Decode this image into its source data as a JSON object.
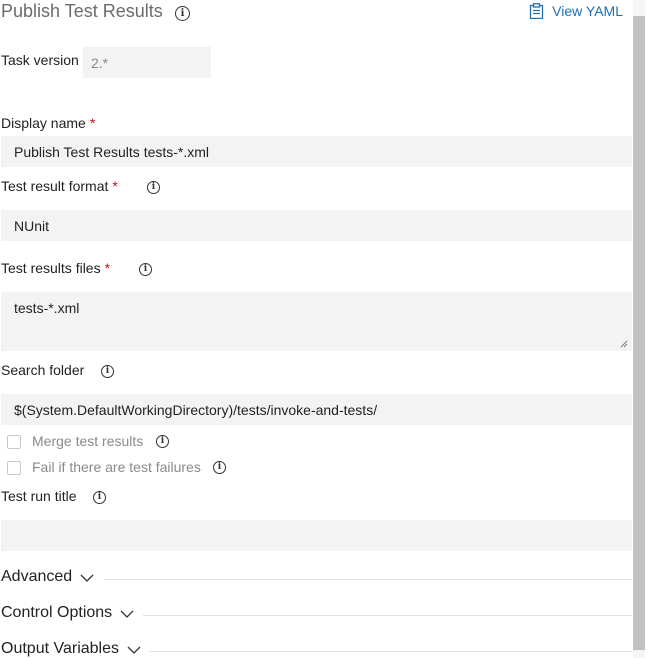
{
  "header": {
    "title": "Publish Test Results",
    "view_yaml": "View YAML"
  },
  "task_version": {
    "label": "Task version",
    "value": "2.*"
  },
  "display_name": {
    "label": "Display name",
    "required": "*",
    "value": "Publish Test Results tests-*.xml"
  },
  "test_result_format": {
    "label": "Test result format",
    "required": "*",
    "value": "NUnit"
  },
  "test_results_files": {
    "label": "Test results files",
    "required": "*",
    "value": "tests-*.xml"
  },
  "search_folder": {
    "label": "Search folder",
    "value": "$(System.DefaultWorkingDirectory)/tests/invoke-and-tests/"
  },
  "merge_results": {
    "label": "Merge test results",
    "checked": false
  },
  "fail_on_failures": {
    "label": "Fail if there are test failures",
    "checked": false
  },
  "test_run_title": {
    "label": "Test run title",
    "value": ""
  },
  "sections": {
    "advanced": "Advanced",
    "control_options": "Control Options",
    "output_variables": "Output Variables"
  },
  "icons": {
    "info": "info-icon",
    "clipboard": "clipboard-icon",
    "chevron": "chevron-down-icon"
  },
  "colors": {
    "link": "#1f6fb5",
    "required": "#c50f1f",
    "field_bg": "#f3f3f3"
  }
}
